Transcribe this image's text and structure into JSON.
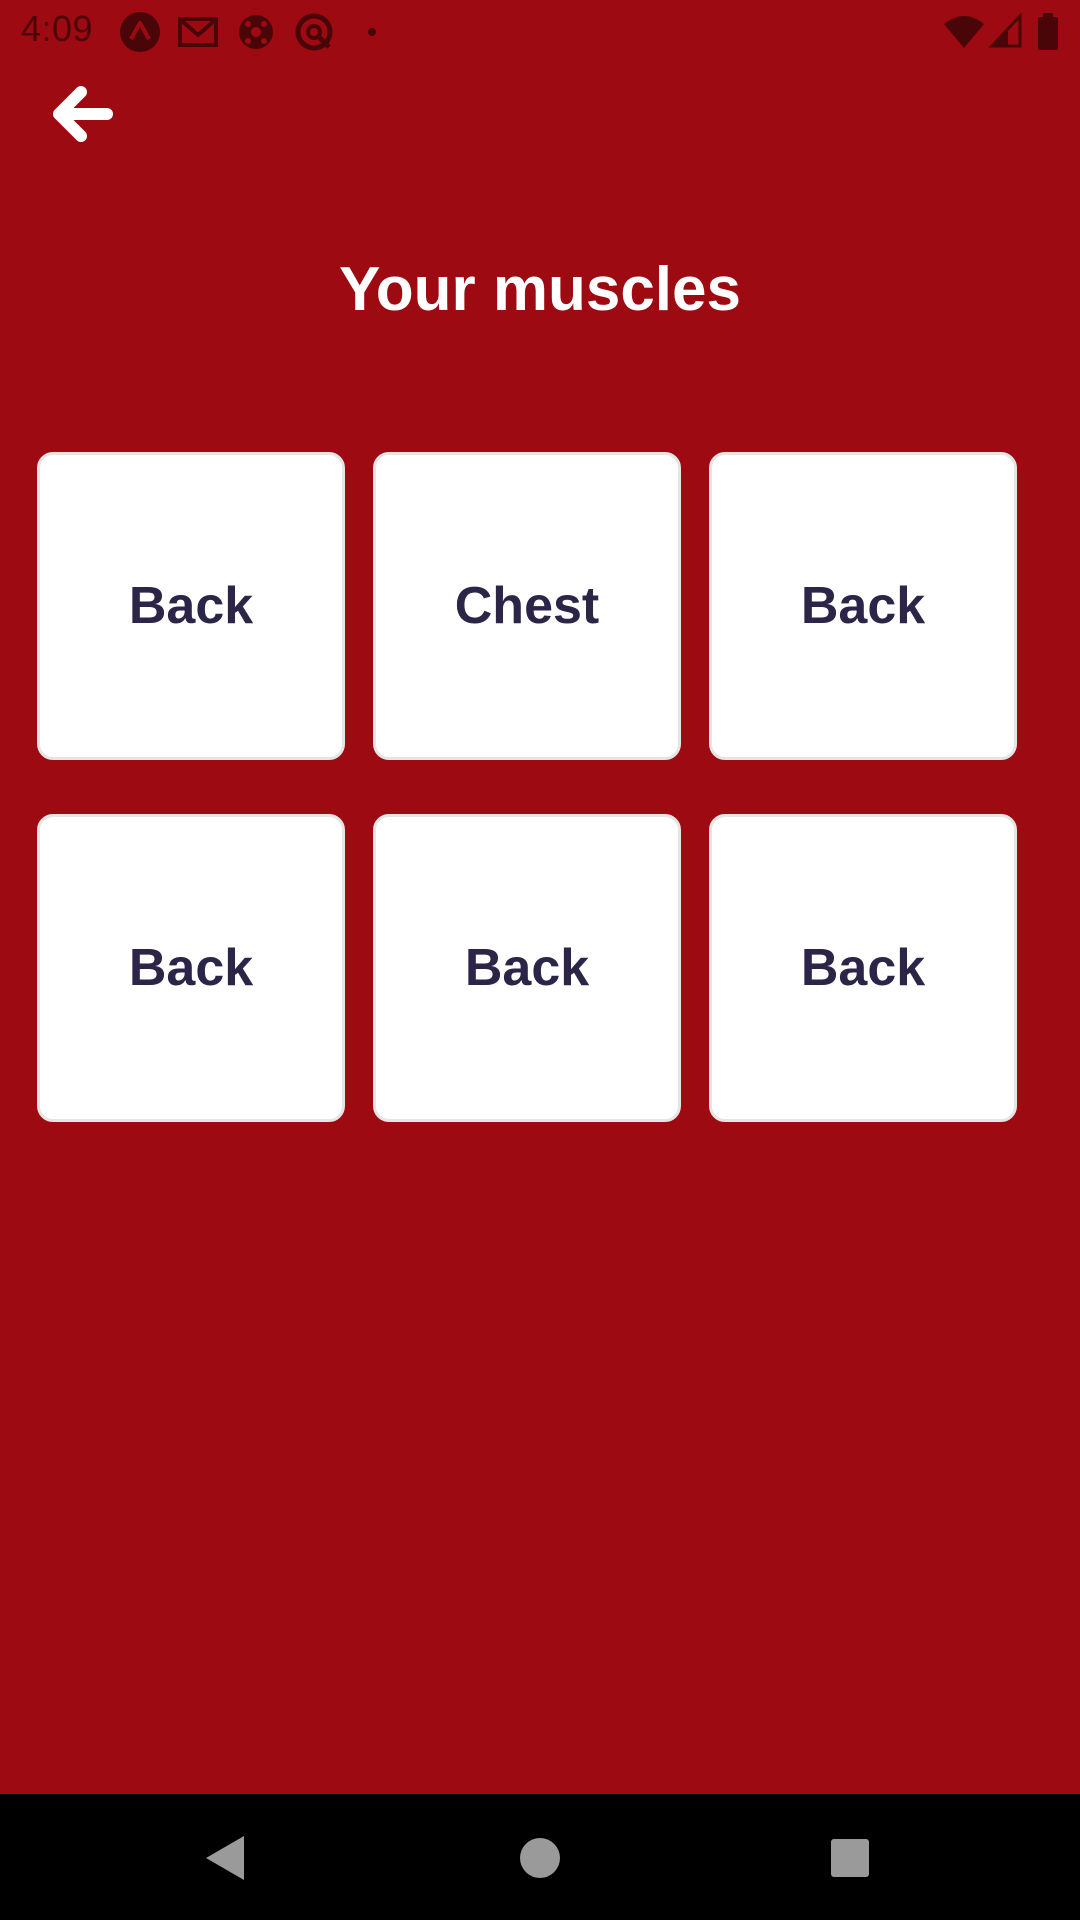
{
  "status_bar": {
    "time": "4:09",
    "left_icons": [
      "app-a-icon",
      "gmail-icon",
      "soccer-ball-icon",
      "target-app-icon",
      "dot-icon"
    ],
    "right_icons": [
      "wifi-icon",
      "signal-icon",
      "battery-icon"
    ]
  },
  "header": {
    "back_icon": "arrow-left-icon",
    "title": "Your muscles"
  },
  "tiles": [
    {
      "label": "Back"
    },
    {
      "label": "Chest"
    },
    {
      "label": "Back"
    },
    {
      "label": "Back"
    },
    {
      "label": "Back"
    },
    {
      "label": "Back"
    }
  ],
  "colors": {
    "background": "#9e0a11",
    "tile_background": "#ffffff",
    "tile_text": "#2d2548",
    "title_text": "#ffffff"
  },
  "nav_bar": {
    "buttons": [
      "nav-back-icon",
      "nav-home-icon",
      "nav-recents-icon"
    ]
  }
}
